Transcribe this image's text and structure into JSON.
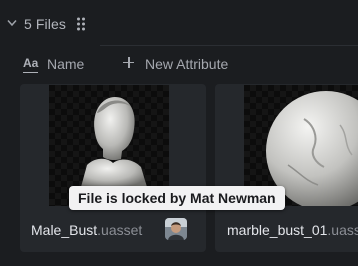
{
  "group": {
    "title": "5 Files"
  },
  "columns": {
    "name_label": "Name",
    "new_attribute_label": "New Attribute"
  },
  "cards": [
    {
      "stem": "Male_Bust",
      "ext": ".uasset"
    },
    {
      "stem": "marble_bust_01",
      "ext": ".uasset"
    }
  ],
  "tooltip": {
    "text": "File is locked by Mat Newman"
  },
  "icons": {
    "collapse": "chevron-down-icon",
    "drag": "grip-icon",
    "text_type": "aa-text-icon",
    "add": "plus-icon"
  },
  "colors": {
    "background": "#1b1d20",
    "card": "#25282c",
    "tooltip_bg": "#f2f2f3"
  }
}
